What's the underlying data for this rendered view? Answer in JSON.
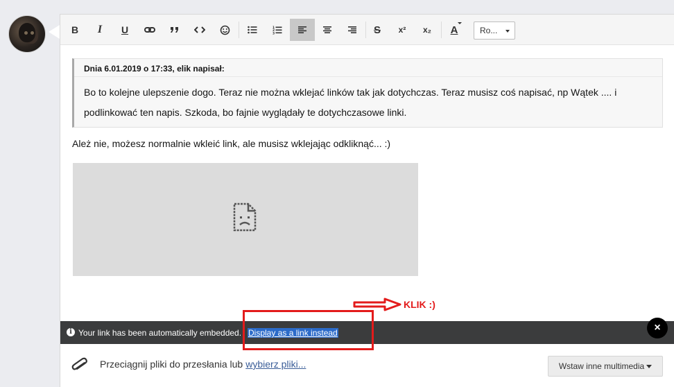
{
  "user": {
    "avatar": "avatar-dog-photo"
  },
  "toolbar": {
    "buttons": [
      {
        "name": "bold",
        "label": "B"
      },
      {
        "name": "italic",
        "label": "I"
      },
      {
        "name": "underline",
        "label": "U"
      },
      {
        "name": "link",
        "label": "link-icon"
      },
      {
        "name": "quote",
        "label": "quote-icon"
      },
      {
        "name": "code",
        "label": "code-icon"
      },
      {
        "name": "smilie",
        "label": "smile-icon"
      },
      {
        "name": "bullet-list",
        "label": "list-ul-icon"
      },
      {
        "name": "number-list",
        "label": "list-ol-icon"
      },
      {
        "name": "align-left",
        "label": "align-left-icon",
        "active": true
      },
      {
        "name": "align-center",
        "label": "align-center-icon"
      },
      {
        "name": "align-right",
        "label": "align-right-icon"
      },
      {
        "name": "strike",
        "label": "S"
      },
      {
        "name": "superscript",
        "label": "x²"
      },
      {
        "name": "subscript",
        "label": "x₂"
      },
      {
        "name": "text-color",
        "label": "A"
      }
    ],
    "font_select": "Ro..."
  },
  "quote": {
    "header": "Dnia 6.01.2019 o 17:33, elik napisał:",
    "line1": "Bo to kolejne ulepszenie dogo. Teraz nie można wklejać linków tak jak dotychczas. Teraz musisz coś napisać, np  Wątek ....  i",
    "line2": "podlinkować ten napis. Szkoda, bo fajnie wyglądały te dotychczasowe linki."
  },
  "reply": "Ależ nie, możesz normalnie wkleić link, ale musisz wklejając odkliknąć... :)",
  "embed": {
    "icon": "broken-file-icon"
  },
  "notice": {
    "message": "Your link has been automatically embedded.",
    "link": "Display as a link instead",
    "close": "×"
  },
  "attach": {
    "drag_text": "Przeciągnij pliki do przesłania lub",
    "choose_link": "wybierz pliki...",
    "media_button": "Wstaw inne multimedia"
  },
  "annotation": {
    "text": "KLIK :)",
    "color": "#e31b1b"
  }
}
